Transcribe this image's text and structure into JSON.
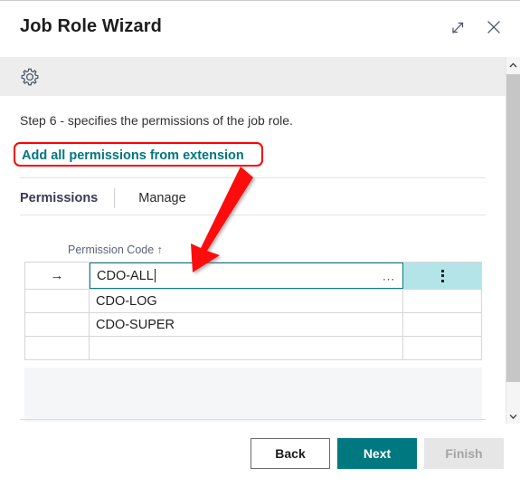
{
  "window": {
    "title": "Job Role Wizard",
    "expand_icon": "expand-diagonal-icon",
    "close_icon": "close-icon"
  },
  "toolbar": {
    "settings_icon": "gear-icon"
  },
  "content": {
    "step_text": "Step 6 - specifies the permissions of the job role.",
    "add_all_link": "Add all permissions from extension"
  },
  "tabs": [
    {
      "label": "Permissions",
      "active": true
    },
    {
      "label": "Manage",
      "active": false
    }
  ],
  "grid": {
    "column_header": "Permission Code ↑",
    "sort_indicator": "↑",
    "row_indicator": "→",
    "lookup_label": "...",
    "kebab_icon": "more-vertical-icon",
    "rows": [
      {
        "code": "CDO-ALL",
        "active": true,
        "editing": true
      },
      {
        "code": "CDO-LOG",
        "active": false,
        "editing": false
      },
      {
        "code": "CDO-SUPER",
        "active": false,
        "editing": false
      },
      {
        "code": "",
        "active": false,
        "editing": false
      }
    ]
  },
  "footer": {
    "back_label": "Back",
    "next_label": "Next",
    "finish_label": "Finish"
  },
  "scrollbar": {
    "up_arrow": "chevron-up-icon",
    "down_arrow": "chevron-down-icon"
  },
  "colors": {
    "accent_teal": "#00787f",
    "link_teal": "#00767d",
    "annotation_red": "#ff0000",
    "active_cell_cyan": "#b2e4e8"
  }
}
